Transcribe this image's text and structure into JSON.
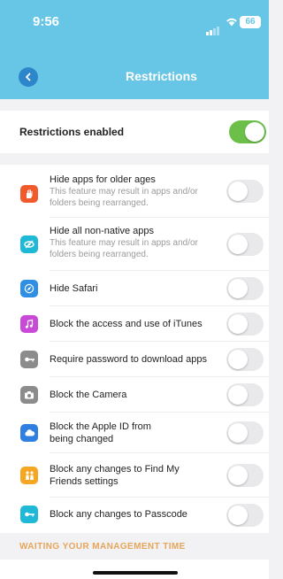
{
  "status_bar": {
    "time": "9:56",
    "battery": "66"
  },
  "header": {
    "title": "Restrictions"
  },
  "restrictions_enabled": {
    "label": "Restrictions enabled",
    "on": true
  },
  "items": [
    {
      "title": "Hide apps for older ages",
      "subtitle": "This feature may result in apps and/or folders being rearranged.",
      "icon": "hand-icon",
      "color": "#f15a2b"
    },
    {
      "title": "Hide all non-native apps",
      "subtitle": "This feature may result in apps and/or folders being rearranged.",
      "icon": "eye-slash-icon",
      "color": "#1fb8d6"
    },
    {
      "title": "Hide Safari",
      "subtitle": "",
      "icon": "compass-icon",
      "color": "#2f8fe4"
    },
    {
      "title": "Block the access and use of iTunes",
      "subtitle": "",
      "icon": "music-note-icon",
      "color": "#c84ad7"
    },
    {
      "title": "Require password to download apps",
      "subtitle": "",
      "icon": "key-icon",
      "color": "#8c8c8c"
    },
    {
      "title": "Block the Camera",
      "subtitle": "",
      "icon": "camera-icon",
      "color": "#8c8c8c"
    },
    {
      "title": "Block the Apple ID from being changed",
      "subtitle": "",
      "icon": "cloud-icon",
      "color": "#2f7fe0"
    },
    {
      "title": "Block any changes to Find My Friends settings",
      "subtitle": "",
      "icon": "friends-icon",
      "color": "#f5a623"
    },
    {
      "title": "Block any changes to Passcode",
      "subtitle": "",
      "icon": "key-icon",
      "color": "#1fb8d6"
    }
  ],
  "section": {
    "title": "WAITING YOUR MANAGEMENT TIME"
  }
}
